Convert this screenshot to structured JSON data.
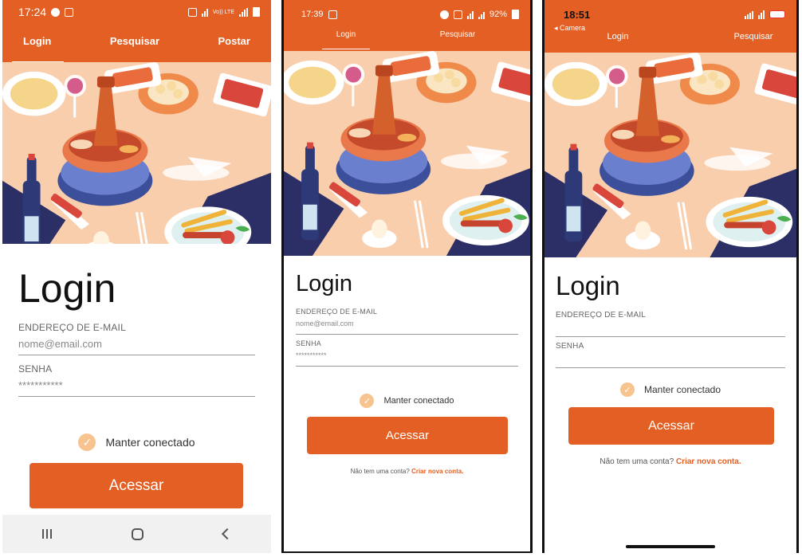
{
  "colors": {
    "accent": "#e35f23",
    "check": "#f7c38f"
  },
  "android_samsung": {
    "status": {
      "time": "17:24",
      "network": "Vo)) LTE"
    },
    "tabs": [
      "Login",
      "Pesquisar",
      "Postar"
    ],
    "title": "Login",
    "email": {
      "label": "ENDEREÇO DE E-MAIL",
      "placeholder": "nome@email.com"
    },
    "password": {
      "label": "SENHA",
      "placeholder": "***********"
    },
    "remember": "Manter conectado",
    "submit": "Acessar",
    "nav_icons": [
      "recents-icon",
      "home-icon",
      "back-icon"
    ]
  },
  "android_small": {
    "status": {
      "time": "17:39",
      "battery": "92%"
    },
    "tabs": [
      "Login",
      "Pesquisar"
    ],
    "title": "Login",
    "email": {
      "label": "ENDEREÇO DE E-MAIL",
      "placeholder": "nome@email.com"
    },
    "password": {
      "label": "SENHA",
      "placeholder": "***********"
    },
    "remember": "Manter conectado",
    "submit": "Acessar",
    "signup": {
      "prompt": "Não tem uma conta?",
      "link": "Criar nova conta."
    }
  },
  "ios": {
    "status": {
      "time": "18:51",
      "back_app": "◂ Camera"
    },
    "tabs": [
      "Login",
      "Pesquisar"
    ],
    "title": "Login",
    "email": {
      "label": "ENDEREÇO DE E-MAIL"
    },
    "password": {
      "label": "SENHA"
    },
    "remember": "Manter conectado",
    "submit": "Acessar",
    "signup": {
      "prompt": "Não tem uma conta?",
      "link": "Criar nova conta."
    }
  }
}
